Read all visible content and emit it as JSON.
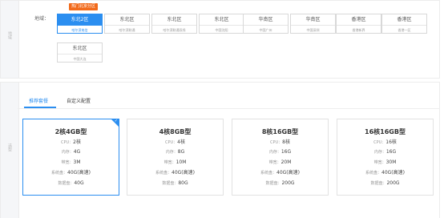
{
  "top_panel": {
    "side_label": "地域",
    "region_label": "地域：",
    "promo_badge": "热门北京分区",
    "zones": [
      {
        "name": "东北2区",
        "sub": "哈尔滨电信",
        "selected": true
      },
      {
        "name": "东北区",
        "sub": "哈尔滨联通",
        "selected": false
      },
      {
        "name": "东北区",
        "sub": "哈尔滨联通双线",
        "selected": false
      },
      {
        "name": "东北区",
        "sub": "中国沈阳",
        "selected": false
      },
      {
        "name": "华南区",
        "sub": "中国广州",
        "selected": false
      },
      {
        "name": "华南区",
        "sub": "中国深圳",
        "selected": false
      },
      {
        "name": "香港区",
        "sub": "香港新界",
        "selected": false
      },
      {
        "name": "香港区",
        "sub": "香港一区",
        "selected": false
      },
      {
        "name": "东北区",
        "sub": "中国大连",
        "selected": false
      }
    ]
  },
  "bottom_panel": {
    "side_label": "选型",
    "tabs": [
      {
        "label": "推荐套餐",
        "active": true
      },
      {
        "label": "自定义配置",
        "active": false
      }
    ],
    "cards": [
      {
        "title": "2核4GB型",
        "selected": true,
        "rows": [
          {
            "key": "CPU：",
            "value": "2核"
          },
          {
            "key": "内存：",
            "value": "4G"
          },
          {
            "key": "带宽：",
            "value": "3M"
          },
          {
            "key": "系统盘：",
            "value": "40G(高速)"
          },
          {
            "key": "数据盘：",
            "value": "40G"
          }
        ]
      },
      {
        "title": "4核8GB型",
        "selected": false,
        "rows": [
          {
            "key": "CPU：",
            "value": "4核"
          },
          {
            "key": "内存：",
            "value": "8G"
          },
          {
            "key": "带宽：",
            "value": "10M"
          },
          {
            "key": "系统盘：",
            "value": "40G(高速)"
          },
          {
            "key": "数据盘：",
            "value": "80G"
          }
        ]
      },
      {
        "title": "8核16GB型",
        "selected": false,
        "rows": [
          {
            "key": "CPU：",
            "value": "8核"
          },
          {
            "key": "内存：",
            "value": "16G"
          },
          {
            "key": "带宽：",
            "value": "20M"
          },
          {
            "key": "系统盘：",
            "value": "40G(高速)"
          },
          {
            "key": "数据盘：",
            "value": "200G"
          }
        ]
      },
      {
        "title": "16核16GB型",
        "selected": false,
        "rows": [
          {
            "key": "CPU：",
            "value": "16核"
          },
          {
            "key": "内存：",
            "value": "16G"
          },
          {
            "key": "带宽：",
            "value": "30M"
          },
          {
            "key": "系统盘：",
            "value": "40G(高速)"
          },
          {
            "key": "数据盘：",
            "value": "200G"
          }
        ]
      }
    ]
  },
  "colors": {
    "accent": "#2b8ef0",
    "promo": "#f26a1b"
  }
}
